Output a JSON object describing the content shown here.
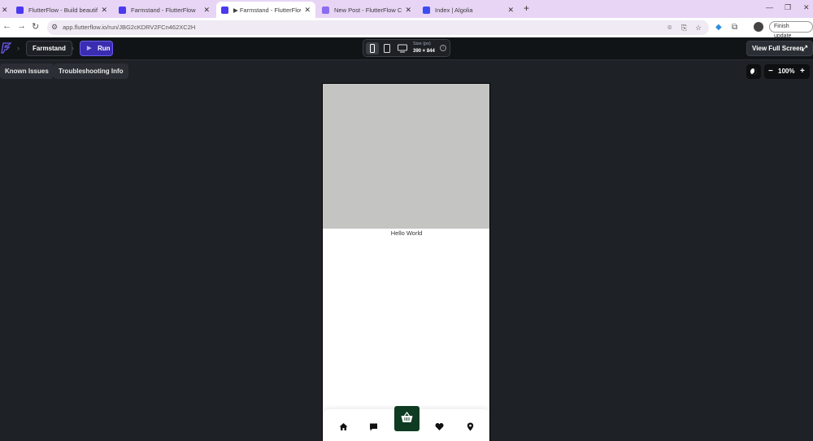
{
  "browser": {
    "tabs": [
      {
        "title": "FlutterFlow - Build beautiful, m",
        "favicon_color": "#4b39ef",
        "active": false
      },
      {
        "title": "Farmstand - FlutterFlow",
        "favicon_color": "#4b39ef",
        "active": false
      },
      {
        "title": "▶ Farmstand - FlutterFlow",
        "favicon_color": "#4b39ef",
        "active": true
      },
      {
        "title": "New Post - FlutterFlow Commu",
        "favicon_color": "#8a6cf0",
        "active": false
      },
      {
        "title": "Index | Algolia",
        "favicon_color": "#3b4cf4",
        "active": false
      }
    ],
    "url": "app.flutterflow.io/run/JBG2cKDRV2FCn462XC2H",
    "finish_update_label": "Finish update"
  },
  "header": {
    "project_name": "Farmstand",
    "run_label": "Run",
    "size_label": "Size (px)",
    "size_value": "390 × 844",
    "view_full_screen_label": "View Full Screen"
  },
  "subbar": {
    "known_issues_label": "Known Issues",
    "troubleshooting_label": "Troubleshooting Info",
    "zoom_value": "100%"
  },
  "preview": {
    "hello_text": "Hello World",
    "nav_icons": [
      "home-icon",
      "chat-icon",
      "basket-icon",
      "heart-icon",
      "location-pin-icon"
    ]
  },
  "colors": {
    "accent": "#4b39ef",
    "run_button": "#3b2db0",
    "cart_button": "#0f3b22",
    "canvas_bg": "#1e2125",
    "hero_placeholder": "#c4c4c2"
  }
}
